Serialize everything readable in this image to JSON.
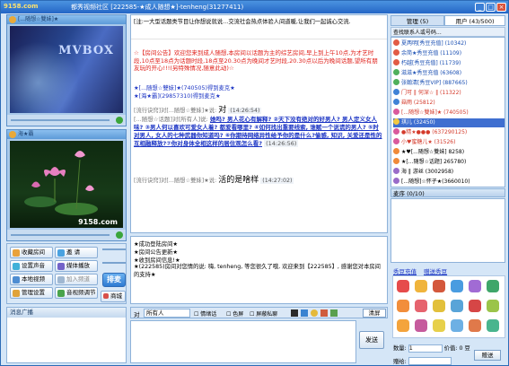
{
  "window": {
    "logo": "9158.com",
    "title": "都秀视频社区 [222585-★成人随想★]-tenheng(31277411)",
    "buttons": [
      "_",
      "□",
      "×"
    ]
  },
  "video1": {
    "label": "[...随想☆雙妹]★",
    "watermark": "MVBOX"
  },
  "video2": {
    "label": "海★霸",
    "watermark": "9158.com"
  },
  "controls": {
    "buttons": [
      "收藏房间",
      "邀 请",
      "设置声音",
      "媒体播放",
      "本地视频",
      "加入频道",
      "管理设置",
      "音视频调节",
      "商城"
    ],
    "big": "排麦"
  },
  "broadcast": {
    "header": "消息广播"
  },
  "chat": {
    "marquee": "[注:一大型话题类节目让你想说就说…交流社会热点体验人间道暖,让我们一起诚心交流.",
    "notice_label": "☆【房间公告】",
    "notice_text": "欢迎您来到成人随想,本房间以话题为主的综艺房间,早上到上午10点,为才艺时段,10点至18点为话题时段,18点至20.30点为晚间才艺时段,20.30点以后为晚间话题,望所有朋友玩的开心!!!(另特殊情况,随意此动)☆",
    "j1": "★[...随想☆雙妹]★(740505)得到麦克★",
    "j2": "★[海★霸](29857310)得到麦克★",
    "m1_head": "[流行诀窍]对[...随想☆雙妹]★说:",
    "m1_body": "对",
    "m1_time": "(14:26:54)",
    "m2_head": "[...随想☆话题]对[所有人]说:",
    "m2_body": "她吗? 男人花心有解释? ②天下没有绝对的好男人?  男人定义女人味? ③男人何以喜欢可爱女人着? 都爱看哪里? ④如何找出重要线索, 谁赋一个说谎的男人? ⑤时对男人, 女人的七种武器你知道吗? ⑥你期待网络异性给予你的是什么?偷感, 知识, 关爱还是性的互相融释放?⑦你对身体全相这样的居住观怎么看?",
    "m2_time": "(14:26:56)",
    "m3_head": "[流行诀窍]对[...随想☆雙妹]★说:",
    "m3_body": "活的是啥样",
    "m3_time": "(14:27:02)",
    "b1": "★成功登陆房间★",
    "b2": "★房间公告更新★",
    "b3": "★收到房间信息!★",
    "b4": "★(222585)房间对您情的说: 嗨, tenheng, 等您很久了哦, 欢迎来到【222585】, 感谢您对本房间的支持★"
  },
  "toolbar": {
    "to_label": "对",
    "to_value": "所有人",
    "opt1": "情绪话",
    "opt2": "色屏",
    "opt3": "屏蔽私聊",
    "clear": "清屏",
    "send": "发送"
  },
  "right": {
    "tab1": "管理 (5)",
    "tab2": "用户 (43/500)",
    "search": "查找联系人或号码...",
    "users": [
      {
        "name": "夏两明[秀豆充值] (10342)",
        "color": "#1a4fb3"
      },
      {
        "name": "余简★秀豆充值 (11109)",
        "color": "#1a4fb3"
      },
      {
        "name": "朽越[秀豆充值] (11739)",
        "color": "#1a4fb3"
      },
      {
        "name": "滋滋★秀豆充值 (63608)",
        "color": "#1a4fb3"
      },
      {
        "name": "张翰清[秀豆VIP] (887665)",
        "color": "#1a4fb3"
      },
      {
        "name": "门可 ‖ 何深☆ ‖ (11322)",
        "color": "#d43a2b"
      },
      {
        "name": "菇雨 (25812)",
        "color": "#d43a2b"
      },
      {
        "name": "[...随想☆雙妹]★ (740505)",
        "color": "#d43a2b"
      },
      {
        "name": "琪儿 (32450)",
        "color": "#d43a2b"
      },
      {
        "name": "●精★●●● (637290125)",
        "color": "#d43a2b"
      },
      {
        "name": "小♥蜜糖儿★ (31526)",
        "color": "#d43a2b"
      },
      {
        "name": "★♥[...随想☆雙妹] 8258)",
        "color": "#000"
      },
      {
        "name": "★[...随想☆话题] 265780)",
        "color": "#000"
      },
      {
        "name": "海 ‖ 游丝 (3002958)",
        "color": "#000"
      },
      {
        "name": "[...随想]☆怀子★(3660010)",
        "color": "#000"
      }
    ],
    "mic": "麦序 (0/10)",
    "gift_tab1": "秀豆充值",
    "gift_tab2": "赠送秀豆",
    "qty_label": "数量:",
    "price_label": "价值:",
    "to_label": "赠给:",
    "qty_value": "1",
    "price_value": "0 豆",
    "gift_send": "赠送"
  }
}
